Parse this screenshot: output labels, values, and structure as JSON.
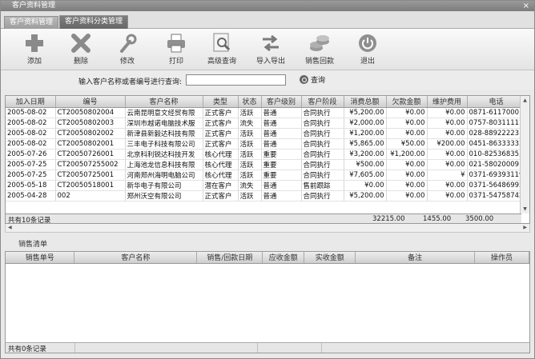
{
  "window": {
    "title": "客户资料管理",
    "close_glyph": "×"
  },
  "tabs": [
    {
      "label": "客户资料管理",
      "active": false
    },
    {
      "label": "客户资料分类管理",
      "active": true
    }
  ],
  "toolbar": {
    "buttons": [
      {
        "label": "添加",
        "icon": "plus-icon"
      },
      {
        "label": "删除",
        "icon": "x-icon"
      },
      {
        "label": "修改",
        "icon": "wrench-icon"
      },
      {
        "label": "打印",
        "icon": "printer-icon"
      },
      {
        "label": "高级查询",
        "icon": "advanced-search-icon"
      },
      {
        "label": "导入导出",
        "icon": "import-export-icon"
      },
      {
        "label": "销售回款",
        "icon": "coins-icon"
      },
      {
        "label": "退出",
        "icon": "power-icon"
      }
    ]
  },
  "search": {
    "label": "输入客户名称或者编号进行查询:",
    "value": "",
    "button_label": "查询"
  },
  "grid": {
    "columns": [
      "加入日期",
      "编号",
      "客户名称",
      "类型",
      "状态",
      "客户级别",
      "客户阶段",
      "消费总额",
      "欠款金额",
      "维护费用",
      "电话"
    ],
    "rows": [
      [
        "2005-08-02",
        "CT20050802004",
        "云南昆明意文经贸有限",
        "正式客户",
        "活跃",
        "普通",
        "合同执行",
        "¥5,200.00",
        "¥0.00",
        "¥0.00",
        "0871-6117000"
      ],
      [
        "2005-08-02",
        "CT20050802003",
        "深圳市越诺电脑技术服",
        "正式客户",
        "流失",
        "普通",
        "合同执行",
        "¥2,000.00",
        "¥0.00",
        "¥0.00",
        "0757-80311111"
      ],
      [
        "2005-08-02",
        "CT20050802002",
        "新津县新毅达科技有限",
        "正式客户",
        "活跃",
        "普通",
        "合同执行",
        "¥1,200.00",
        "¥0.00",
        "¥0.00",
        "028-88922223"
      ],
      [
        "2005-08-02",
        "CT20050802001",
        "三丰电子科技有限公司",
        "正式客户",
        "活跃",
        "普通",
        "合同执行",
        "¥5,865.00",
        "¥50.00",
        "¥200.00",
        "0451-86333333"
      ],
      [
        "2005-07-26",
        "CT20050726001",
        "北京科利锐达科技开发",
        "核心代理",
        "活跃",
        "重要",
        "合同执行",
        "¥3,200.00",
        "¥1,200.00",
        "¥0.00",
        "010-82536835,"
      ],
      [
        "2005-07-25",
        "CT200507255002",
        "上海池龙信息科技有限",
        "核心代理",
        "活跃",
        "重要",
        "合同执行",
        "¥500.00",
        "¥0.00",
        "¥0.00",
        "021-58020009"
      ],
      [
        "2005-07-25",
        "CT20050725001",
        "河南郑州海明电脑公司",
        "核心代理",
        "活跃",
        "重要",
        "合同执行",
        "¥7,605.00",
        "¥0.00",
        "¥",
        "0371-69393119"
      ],
      [
        "2005-05-18",
        "CT20050518001",
        "新华电子有限公司",
        "潜在客户",
        "流失",
        "普通",
        "售前跟踪",
        "¥0.00",
        "¥0.00",
        "¥0.00",
        "0371-56486995"
      ],
      [
        "2005-04-28",
        "002",
        "郑州沃空有限公司",
        "正式客户",
        "活跃",
        "普通",
        "合同执行",
        "¥5,200.00",
        "¥0.00",
        "¥0.00",
        "0371-54758742"
      ]
    ],
    "footer": {
      "count_label": "共有10条记录",
      "total_consume": "32215.00",
      "total_debt": "1455.00",
      "total_maintain": "3500.00"
    }
  },
  "sales": {
    "title": "销售清单",
    "columns": [
      "销售单号",
      "客户名称",
      "销售/回款日期",
      "应收金额",
      "实收金额",
      "备注",
      "操作员"
    ],
    "footer_label": "共有0条记录"
  }
}
